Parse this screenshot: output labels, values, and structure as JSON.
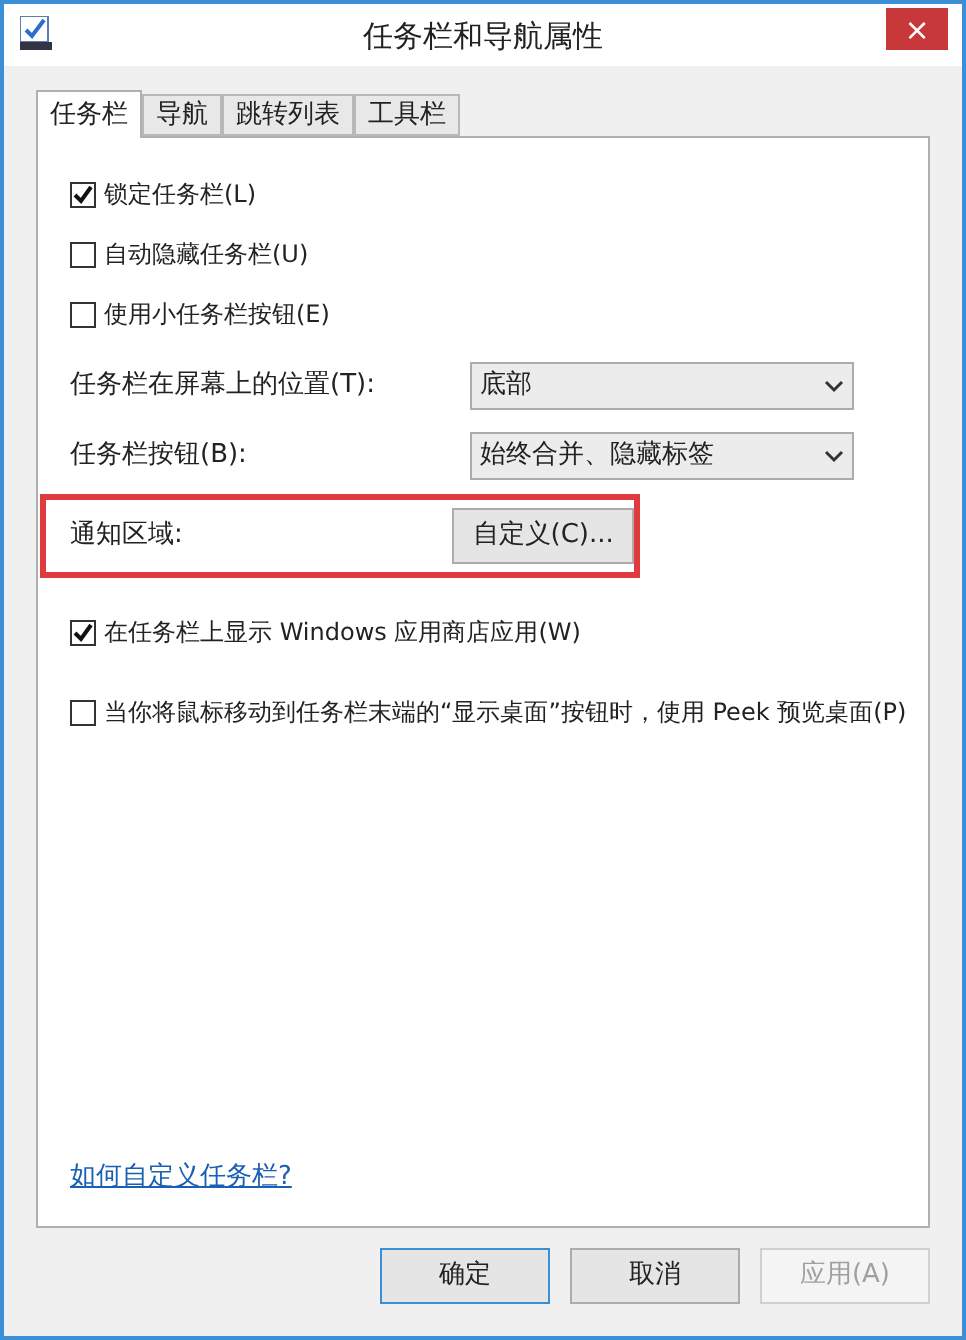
{
  "window": {
    "title": "任务栏和导航属性",
    "close": "×"
  },
  "tabs": [
    {
      "label": "任务栏",
      "selected": true
    },
    {
      "label": "导航",
      "selected": false
    },
    {
      "label": "跳转列表",
      "selected": false
    },
    {
      "label": "工具栏",
      "selected": false
    }
  ],
  "options_top": [
    {
      "label": "锁定任务栏(L)",
      "checked": true
    },
    {
      "label": "自动隐藏任务栏(U)",
      "checked": false
    },
    {
      "label": "使用小任务栏按钮(E)",
      "checked": false
    }
  ],
  "settings": [
    {
      "kind": "dropdown",
      "label": "任务栏在屏幕上的位置(T):",
      "value": "底部",
      "highlighted": false
    },
    {
      "kind": "dropdown",
      "label": "任务栏按钮(B):",
      "value": "始终合并、隐藏标签",
      "highlighted": false
    },
    {
      "kind": "button",
      "label": "通知区域:",
      "value": "自定义(C)...",
      "highlighted": true
    }
  ],
  "options_bottom": [
    {
      "label": "在任务栏上显示 Windows 应用商店应用(W)",
      "checked": true
    },
    {
      "label": "当你将鼠标移动到任务栏末端的“显示桌面”按钮时，使用 Peek 预览桌面(P)",
      "checked": false
    }
  ],
  "help_link": "如何自定义任务栏?",
  "buttons": [
    {
      "label": "确定",
      "disabled": false,
      "default": true
    },
    {
      "label": "取消",
      "disabled": false,
      "default": false
    },
    {
      "label": "应用(A)",
      "disabled": true,
      "default": false
    }
  ]
}
